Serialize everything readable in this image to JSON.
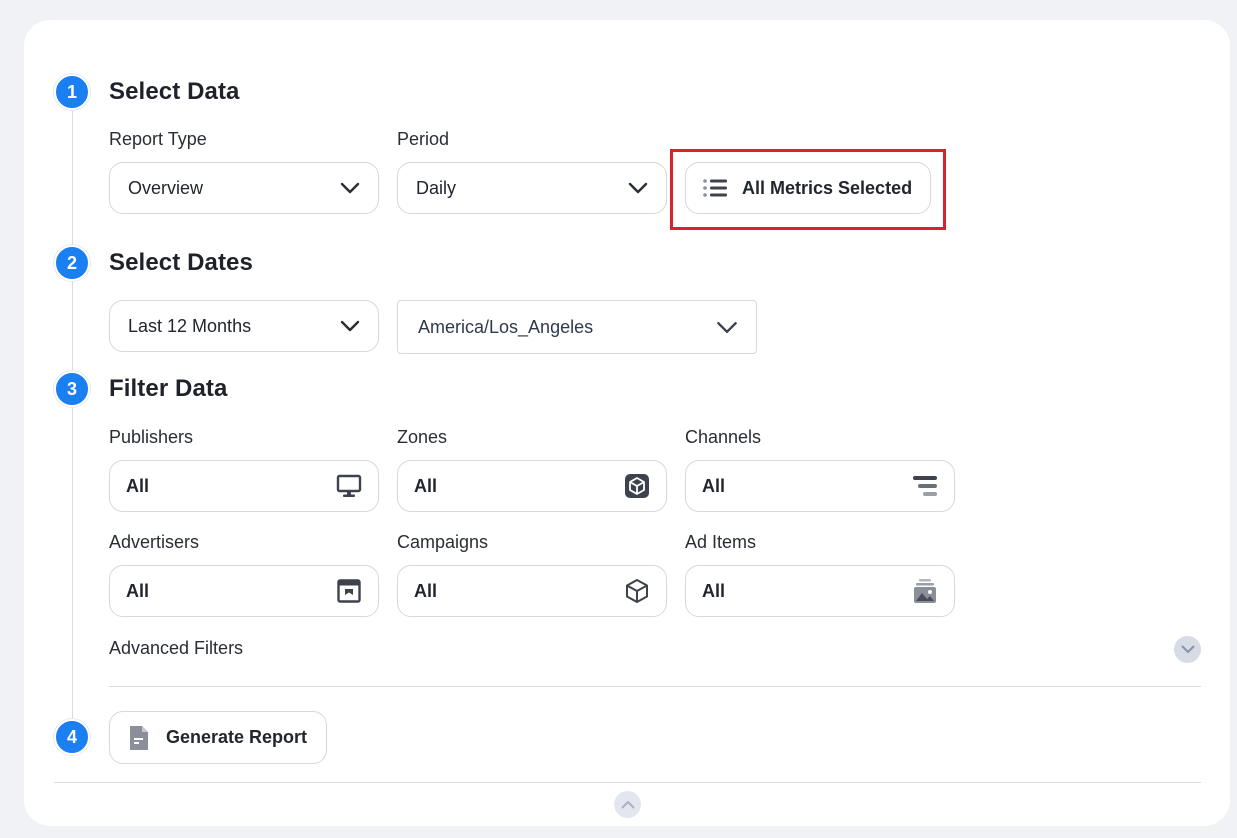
{
  "steps": [
    {
      "number": "1",
      "title": "Select Data"
    },
    {
      "number": "2",
      "title": "Select Dates"
    },
    {
      "number": "3",
      "title": "Filter Data"
    },
    {
      "number": "4",
      "title": ""
    }
  ],
  "select_data": {
    "report_type_label": "Report Type",
    "report_type_value": "Overview",
    "period_label": "Period",
    "period_value": "Daily",
    "metrics_button": "All Metrics Selected"
  },
  "select_dates": {
    "range_value": "Last 12 Months",
    "timezone_value": "America/Los_Angeles"
  },
  "filters": [
    {
      "label": "Publishers",
      "value": "All",
      "icon": "monitor-icon"
    },
    {
      "label": "Zones",
      "value": "All",
      "icon": "cube-filled-icon"
    },
    {
      "label": "Channels",
      "value": "All",
      "icon": "channels-icon"
    },
    {
      "label": "Advertisers",
      "value": "All",
      "icon": "storefront-icon"
    },
    {
      "label": "Campaigns",
      "value": "All",
      "icon": "cube-outline-icon"
    },
    {
      "label": "Ad Items",
      "value": "All",
      "icon": "image-stack-icon"
    }
  ],
  "advanced_filters_label": "Advanced Filters",
  "generate_report_label": "Generate Report",
  "colors": {
    "accent": "#1a7ff1",
    "highlight": "#d9232a",
    "background": "#f1f2f6"
  }
}
